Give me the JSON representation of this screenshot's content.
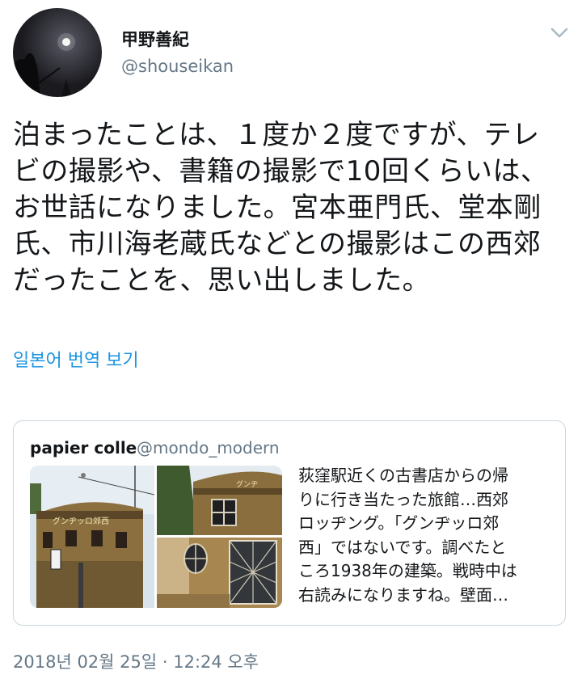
{
  "author": {
    "display_name": "甲野善紀",
    "handle": "@shouseikan"
  },
  "tweet": {
    "text": "泊まったことは、１度か２度ですが、テレ\nビの撮影や、書籍の撮影で10回くらいは、\nお世話になりました。宮本亜門氏、堂本剛\n氏、市川海老蔵氏などとの撮影はこの西郊\nだったことを、思い出しました。",
    "translate_link": "일본어 번역 보기",
    "timestamp": "2018년 02월 25일 · 12:24 오후"
  },
  "quoted_tweet": {
    "display_name": "papier colle",
    "handle": "@mondo_modern",
    "text": "荻窪駅近くの古書店からの帰\nりに行き当たった旅館…西郊\nロッヂング。「グンヂッロ郊\n西」ではないです。調べたと\nころ1938年の建築。戦時中は\n右読みになりますね。壁面…",
    "photo_sign_text": "グンヂッロ郊西"
  },
  "icons": {
    "menu": "chevron-down-icon",
    "avatar": "avatar-moon-night"
  },
  "colors": {
    "link": "#1b95e0",
    "secondary_text": "#657786",
    "border": "#ccd6dd"
  }
}
